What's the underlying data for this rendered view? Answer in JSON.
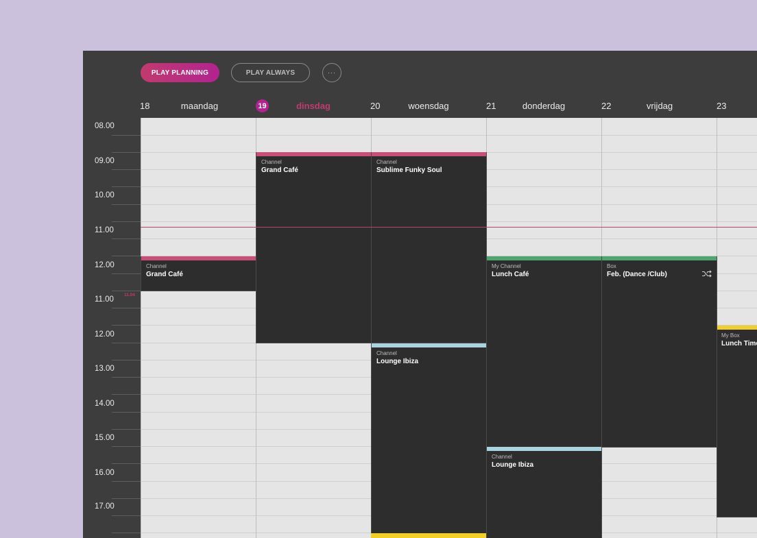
{
  "toolbar": {
    "play_planning": "PLAY PLANNING",
    "play_always": "PLAY ALWAYS",
    "more": "···"
  },
  "days": [
    {
      "num": "18",
      "name": "maandag",
      "today": false
    },
    {
      "num": "19",
      "name": "dinsdag",
      "today": true
    },
    {
      "num": "20",
      "name": "woensdag",
      "today": false
    },
    {
      "num": "21",
      "name": "donderdag",
      "today": false
    },
    {
      "num": "22",
      "name": "vrijdag",
      "today": false
    },
    {
      "num": "23",
      "name": "",
      "today": false
    }
  ],
  "time_labels": [
    "08.00",
    "09.00",
    "10.00",
    "11.00",
    "12.00",
    "11.00",
    "12.00",
    "13.00",
    "14.00",
    "15.00",
    "16.00",
    "17.00"
  ],
  "now_label": "11.04",
  "colors": {
    "pink": "#c84f77",
    "green": "#4fa56f",
    "blue": "#a9d3df",
    "yellow": "#f1cf26",
    "accent": "#b2238f"
  },
  "blocks": {
    "mon_grand_cafe": {
      "type": "Channel",
      "title": "Grand Café",
      "color": "pink"
    },
    "tue_grand_cafe": {
      "type": "Channel",
      "title": "Grand Café",
      "color": "pink"
    },
    "wed_sublime": {
      "type": "Channel",
      "title": "Sublime Funky Soul",
      "color": "pink"
    },
    "wed_lounge": {
      "type": "Channel",
      "title": "Lounge Ibiza",
      "color": "blue"
    },
    "thu_lunch": {
      "type": "My Channel",
      "title": "Lunch Café",
      "color": "green"
    },
    "thu_lounge": {
      "type": "Channel",
      "title": "Lounge Ibiza",
      "color": "blue"
    },
    "fri_feb": {
      "type": "Box",
      "title": "Feb. (Dance /Club)",
      "color": "green",
      "icon": "shuffle-icon"
    },
    "sat_lunch": {
      "type": "My Box",
      "title": "Lunch Time",
      "color": "yellow"
    }
  }
}
